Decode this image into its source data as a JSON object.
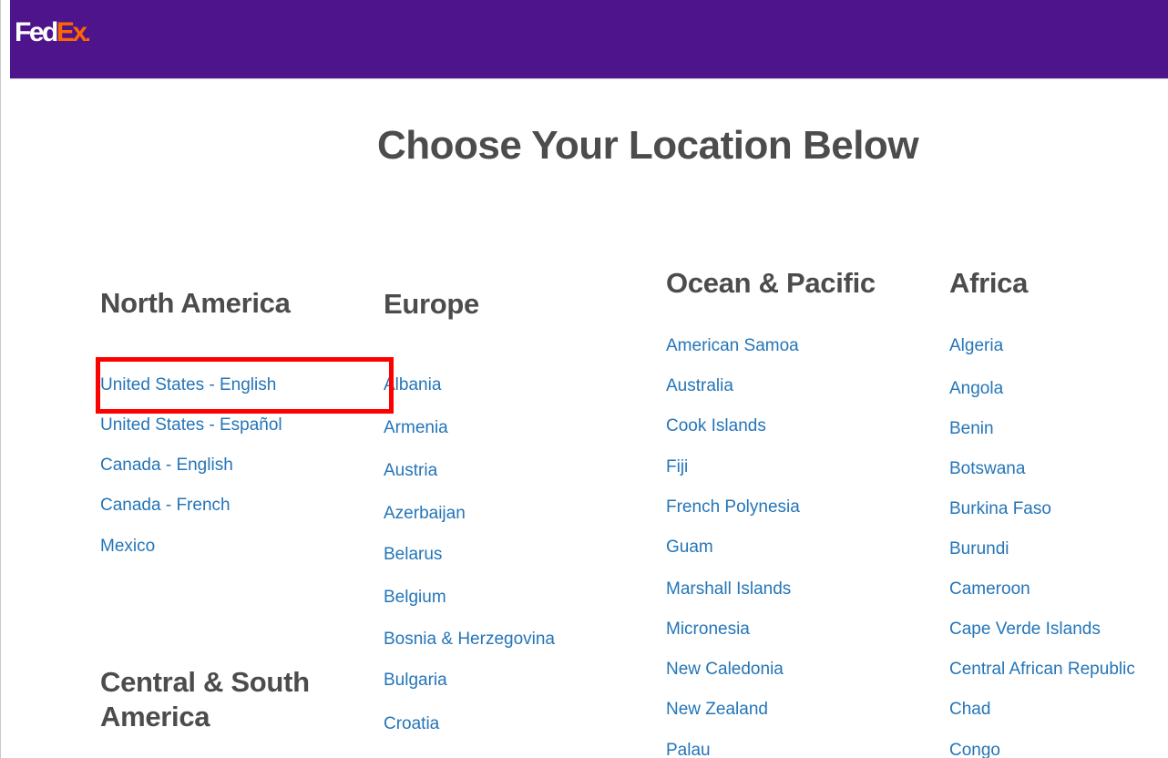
{
  "header": {
    "logo_fed": "Fed",
    "logo_ex": "Ex",
    "logo_dot": ".",
    "brand_color": "#4d148c",
    "accent_color": "#ff6600"
  },
  "page_title": "Choose Your Location Below",
  "regions": {
    "north_america": {
      "heading": "North America",
      "links": [
        "United States - English",
        "United States - Español",
        "Canada - English",
        "Canada - French",
        "Mexico"
      ]
    },
    "central_south_america": {
      "heading": "Central & South America"
    },
    "europe": {
      "heading": "Europe",
      "links": [
        "Albania",
        "Armenia",
        "Austria",
        "Azerbaijan",
        "Belarus",
        "Belgium",
        "Bosnia & Herzegovina",
        "Bulgaria",
        "Croatia"
      ]
    },
    "ocean_pacific": {
      "heading": "Ocean & Pacific",
      "links": [
        "American Samoa",
        "Australia",
        "Cook Islands",
        "Fiji",
        "French Polynesia",
        "Guam",
        "Marshall Islands",
        "Micronesia",
        "New Caledonia",
        "New Zealand",
        "Palau"
      ]
    },
    "africa": {
      "heading": "Africa",
      "links": [
        "Algeria",
        "Angola",
        "Benin",
        "Botswana",
        "Burkina Faso",
        "Burundi",
        "Cameroon",
        "Cape Verde Islands",
        "Central African Republic",
        "Chad",
        "Congo"
      ]
    }
  },
  "colors": {
    "link": "#2475b8",
    "heading": "#4c4c4c",
    "highlight": "#ff0000"
  }
}
